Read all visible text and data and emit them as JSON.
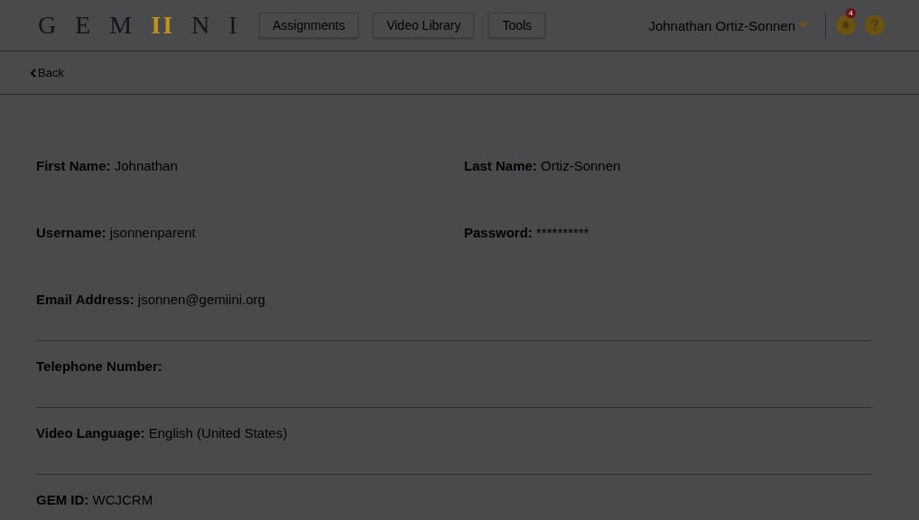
{
  "header": {
    "logo": [
      {
        "text": "GEM",
        "accent": false
      },
      {
        "text": "II",
        "accent": true
      },
      {
        "text": "NI",
        "accent": false
      }
    ],
    "nav": [
      "Assignments",
      "Video Library",
      "Tools"
    ],
    "user": "Johnathan Ortiz-Sonnen",
    "notifications": "4"
  },
  "back": "Back",
  "rows": [
    {
      "rule_below": false,
      "fields": [
        {
          "label": "First Name:",
          "value": "Johnathan"
        },
        {
          "label": "Last Name:",
          "value": "Ortiz-Sonnen"
        }
      ]
    },
    {
      "rule_below": false,
      "fields": [
        {
          "label": "Username:",
          "value": "jsonnenparent"
        },
        {
          "label": "Password:",
          "value": "**********"
        }
      ]
    },
    {
      "rule_below": true,
      "fields": [
        {
          "label": "Email Address:",
          "value": "jsonnen@gemiini.org"
        }
      ]
    },
    {
      "rule_below": true,
      "fields": [
        {
          "label": "Telephone Number:"
        }
      ]
    },
    {
      "rule_below": true,
      "fields": [
        {
          "label": "Video Language:",
          "value": "English (United States)"
        }
      ]
    },
    {
      "rule_below": false,
      "fields": [
        {
          "label": "GEM ID:",
          "value": "WCJCRM"
        }
      ]
    }
  ]
}
